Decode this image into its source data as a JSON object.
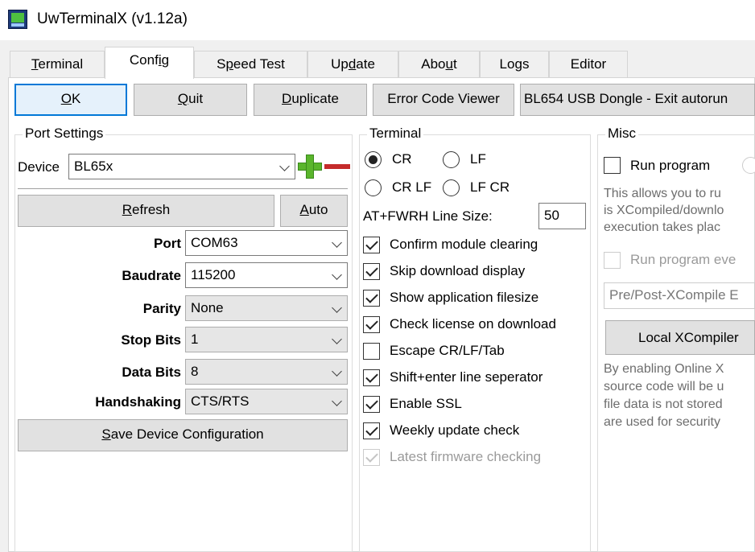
{
  "window": {
    "title": "UwTerminalX (v1.12a)"
  },
  "tabs": [
    {
      "label": "Terminal",
      "underline_index": 0,
      "active": false
    },
    {
      "label": "Config",
      "underline_index": 4,
      "active": true
    },
    {
      "label": "Speed Test",
      "underline_index": 1,
      "active": false
    },
    {
      "label": "Update",
      "underline_index": 2,
      "active": false
    },
    {
      "label": "About",
      "underline_index": 3,
      "active": false
    },
    {
      "label": "Logs",
      "underline_index": 2,
      "active": false
    },
    {
      "label": "Editor",
      "underline_index": -1,
      "active": false
    }
  ],
  "toolbar": {
    "ok_pre": "",
    "ok_u": "O",
    "ok_post": "K",
    "quit_pre": "",
    "quit_u": "Q",
    "quit_post": "uit",
    "duplicate_pre": "",
    "duplicate_u": "D",
    "duplicate_post": "uplicate",
    "error_code_viewer": "Error Code Viewer",
    "bl654_exit": "BL654 USB Dongle - Exit autorun"
  },
  "port_settings": {
    "title": "Port Settings",
    "device_label": "Device",
    "device_value": "BL65x",
    "refresh_pre": "",
    "refresh_u": "R",
    "refresh_post": "efresh",
    "auto_pre": "",
    "auto_u": "A",
    "auto_post": "uto",
    "port_label": "Port",
    "port_value": "COM63",
    "baudrate_label": "Baudrate",
    "baudrate_value": "115200",
    "parity_label": "Parity",
    "parity_value": "None",
    "stopbits_label": "Stop Bits",
    "stopbits_value": "1",
    "databits_label": "Data Bits",
    "databits_value": "8",
    "handshaking_label": "Handshaking",
    "handshaking_value": "CTS/RTS",
    "save_pre": "",
    "save_u": "S",
    "save_post": "ave Device Configuration"
  },
  "terminal": {
    "title": "Terminal",
    "radio_cr": "CR",
    "radio_lf": "LF",
    "radio_crlf": "CR LF",
    "radio_lfcr": "LF CR",
    "fwrh_label": "AT+FWRH Line Size:",
    "fwrh_value": "50",
    "checks": [
      {
        "label": "Confirm module clearing",
        "checked": true,
        "disabled": false
      },
      {
        "label": "Skip download display",
        "checked": true,
        "disabled": false
      },
      {
        "label": "Show application filesize",
        "checked": true,
        "disabled": false
      },
      {
        "label": "Check license on download",
        "checked": true,
        "disabled": false
      },
      {
        "label": "Escape CR/LF/Tab",
        "checked": false,
        "disabled": false
      },
      {
        "label": "Shift+enter line seperator",
        "checked": true,
        "disabled": false
      },
      {
        "label": "Enable SSL",
        "checked": true,
        "disabled": false
      },
      {
        "label": "Weekly update check",
        "checked": true,
        "disabled": false
      },
      {
        "label": "Latest firmware checking",
        "checked": true,
        "disabled": true
      }
    ]
  },
  "misc": {
    "title": "Misc",
    "run_program": "Run program",
    "desc1_line1": "This allows you to ru",
    "desc1_line2": "is XCompiled/downlo",
    "desc1_line3": "execution takes plac",
    "run_program_every": "Run program eve",
    "pre_post_placeholder": "Pre/Post-XCompile E",
    "local_xcompiler": "Local XCompiler",
    "desc2_line1": "By enabling Online X",
    "desc2_line2": "source code will be u",
    "desc2_line3": "file data is not stored",
    "desc2_line4": "are used for security"
  },
  "colors": {
    "accent": "#0078d7",
    "plus": "#5ab52c",
    "minus": "#c42b2b"
  }
}
